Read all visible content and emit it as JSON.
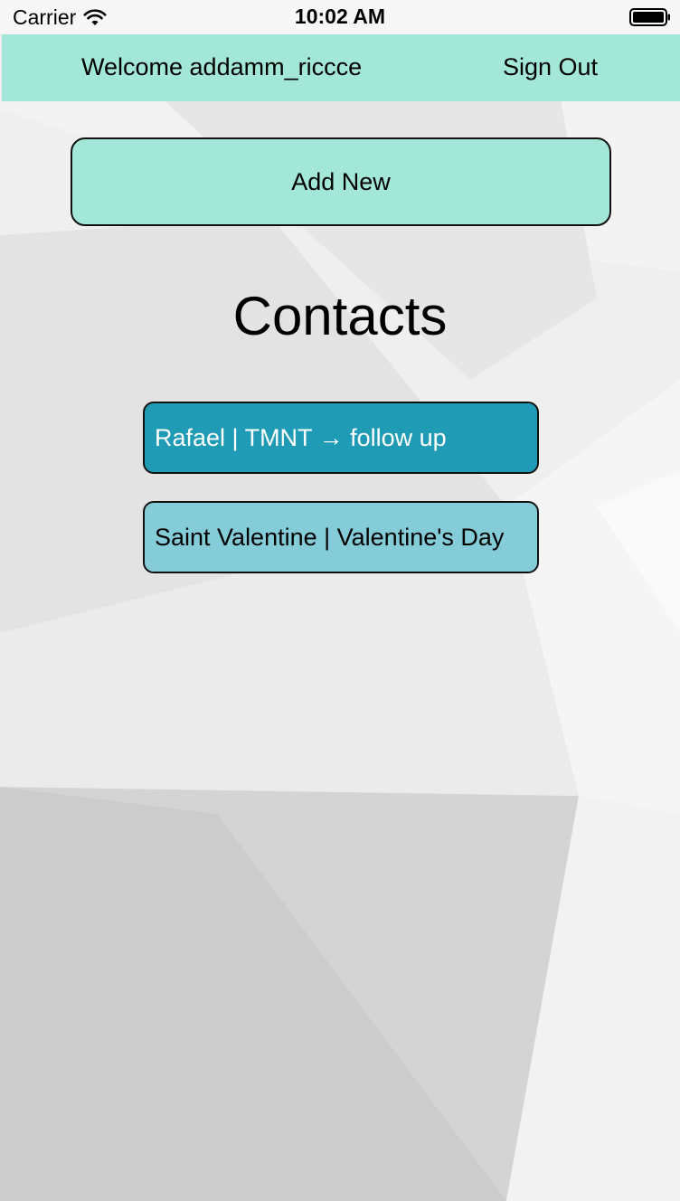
{
  "status_bar": {
    "carrier": "Carrier",
    "time": "10:02 AM"
  },
  "nav": {
    "welcome": "Welcome addamm_riccce",
    "sign_out": "Sign Out"
  },
  "actions": {
    "add_new": "Add New"
  },
  "contacts": {
    "title": "Contacts",
    "items": [
      {
        "label": "Rafael | TMNT → follow up"
      },
      {
        "label": "Saint Valentine | Valentine's Day"
      }
    ]
  },
  "colors": {
    "nav_background": "#a2e7d8",
    "selected_contact": "#1f9bb6",
    "contact": "#84ccd7"
  }
}
